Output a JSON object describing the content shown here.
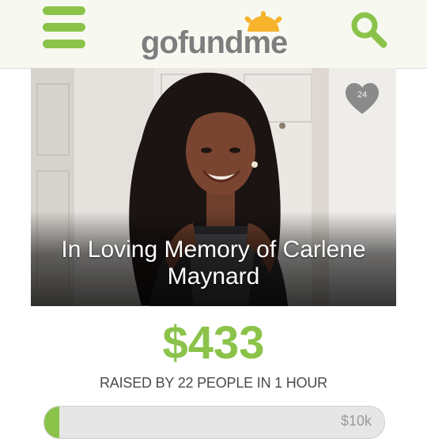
{
  "header": {
    "logo_text": "gofundme",
    "menu_icon": "hamburger-menu-icon",
    "search_icon": "search-icon",
    "brand_color": "#8bc34a",
    "sun_color": "#f7b32b"
  },
  "campaign": {
    "title": "In Loving Memory of Carlene Maynard",
    "hearts": "24",
    "amount_raised": "$433",
    "raised_text": "RAISED BY 22 PEOPLE IN 1 HOUR",
    "goal": "$10k",
    "progress_fraction": 0.0433
  }
}
